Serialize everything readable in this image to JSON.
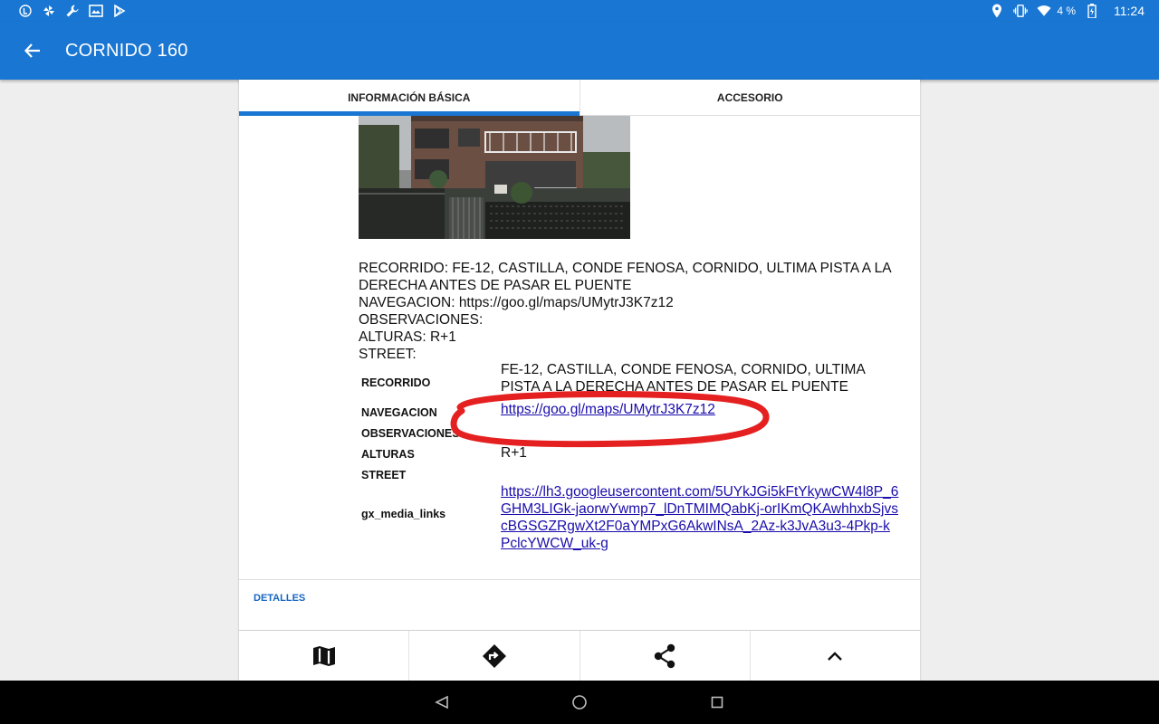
{
  "status_bar": {
    "battery_percent": "4 %",
    "time": "11:24",
    "left_icons": [
      "launcher-icon",
      "pinwheel-icon",
      "wrench-icon",
      "image-mail-icon",
      "play-store-icon"
    ],
    "right_icons": [
      "location-icon",
      "vibrate-icon",
      "wifi-icon",
      "battery-charging-icon"
    ]
  },
  "app_bar": {
    "title": "CORNIDO 160",
    "color": "#1976d2"
  },
  "tabs": [
    {
      "label": "INFORMACIÓN BÁSICA",
      "active": true
    },
    {
      "label": "ACCESORIO",
      "active": false
    }
  ],
  "description": {
    "lines": [
      "RECORRIDO: FE-12, CASTILLA, CONDE FENOSA, CORNIDO, ULTIMA PISTA A LA DERECHA ANTES DE PASAR EL PUENTE",
      "NAVEGACION: https://goo.gl/maps/UMytrJ3K7z12",
      "OBSERVACIONES:",
      "ALTURAS: R+1",
      "STREET:"
    ]
  },
  "attributes": [
    {
      "key": "RECORRIDO",
      "value": "FE-12, CASTILLA, CONDE FENOSA, CORNIDO, ULTIMA PISTA A LA DERECHA ANTES DE PASAR EL PUENTE"
    },
    {
      "key": "NAVEGACION",
      "value": "https://goo.gl/maps/UMytrJ3K7z12"
    },
    {
      "key": "OBSERVACIONES",
      "value": ""
    },
    {
      "key": "ALTURAS",
      "value": "R+1"
    },
    {
      "key": "STREET",
      "value": ""
    },
    {
      "key": "gx_media_links",
      "value": "https://lh3.googleusercontent.com/5UYkJGi5kFtYkywCW4l8P_6GHM3LIGk-jaorwYwmp7_lDnTMIMQabKj-orIKmQKAwhhxbSjvscBGSGZRgwXt2F0aYMPxG6AkwINsA_2Az-k3JvA3u3-4Pkp-kPclcYWCW_uk-g"
    }
  ],
  "section": {
    "detalles_label": "DETALLES",
    "accent": "#1565c0"
  },
  "annotation": {
    "color": "#e52020"
  },
  "bottom_actions": [
    {
      "icon": "map-icon"
    },
    {
      "icon": "directions-icon"
    },
    {
      "icon": "share-icon"
    },
    {
      "icon": "chevron-up-icon"
    }
  ],
  "nav_bar": {
    "buttons": [
      "back-triangle-icon",
      "home-circle-icon",
      "recents-square-icon"
    ]
  }
}
